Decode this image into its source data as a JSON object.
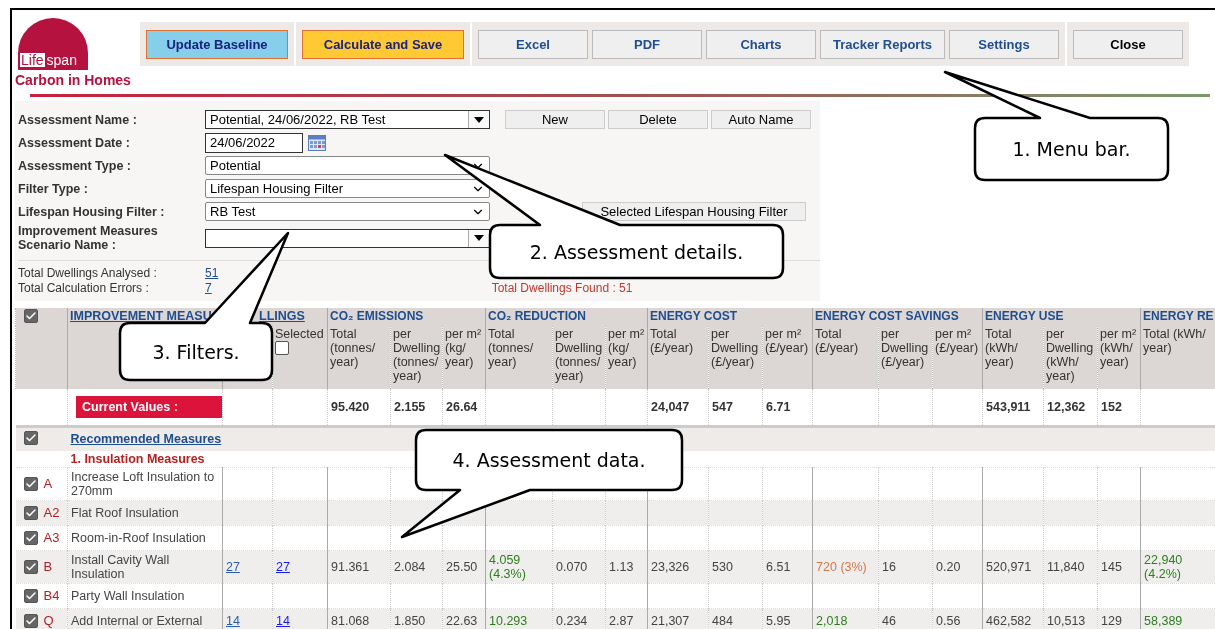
{
  "logo": {
    "word_1": "Life",
    "word_2": "span",
    "subtitle": "Carbon in Homes"
  },
  "toolbar_groups": [
    {
      "buttons": [
        {
          "label": "Update Baseline",
          "kind": "primary"
        }
      ]
    },
    {
      "buttons": [
        {
          "label": "Calculate and Save",
          "kind": "accent"
        }
      ]
    },
    {
      "buttons": [
        {
          "label": "Excel",
          "kind": "normal"
        },
        {
          "label": "PDF",
          "kind": "normal"
        },
        {
          "label": "Charts",
          "kind": "normal"
        },
        {
          "label": "Tracker Reports",
          "kind": "normal"
        },
        {
          "label": "Settings",
          "kind": "normal"
        }
      ]
    },
    {
      "buttons": [
        {
          "label": "Close",
          "kind": "close"
        }
      ]
    }
  ],
  "form": {
    "fields": [
      {
        "label": "Assessment Name :",
        "value": "Potential, 24/06/2022, RB Test",
        "kind": "combo"
      },
      {
        "label": "Assessment Date :",
        "value": "24/06/2022",
        "kind": "date"
      },
      {
        "label": "Assessment Type :",
        "value": "Potential",
        "kind": "select"
      },
      {
        "label": "Filter Type :",
        "value": "Lifespan Housing Filter",
        "kind": "select"
      },
      {
        "label": "Lifespan Housing Filter :",
        "value": "RB Test",
        "kind": "select"
      },
      {
        "label": "Improvement Measures Scenario Name :",
        "kind": "combo"
      }
    ],
    "buttons": [
      "New",
      "Delete",
      "Auto Name"
    ],
    "filter_button": "Selected Lifespan Housing Filter",
    "totals": [
      {
        "label": "Total Dwellings Analysed :",
        "value": "51"
      },
      {
        "label": "Total Calculation Errors :",
        "value": "7"
      }
    ],
    "found": "Total Dwellings Found : 51"
  },
  "table": {
    "all_checked": true,
    "measure_title": "IMPROVEMENT MEASU",
    "dwellings": {
      "title": "LLINGS",
      "selected_label": "Selected",
      "selected_checked": false
    },
    "groups": [
      {
        "title": "CO₂ EMISSIONS",
        "columns": [
          "Total (tonnes/ year)",
          "per Dwelling (tonnes/ year)",
          "per m² (kg/ year)"
        ],
        "current": [
          "95.420",
          "2.155",
          "26.64"
        ]
      },
      {
        "title": "CO₂ REDUCTION",
        "columns": [
          "Total (tonnes/ year)",
          "per Dwelling (tonnes/ year)",
          "per m² (kg/ year)"
        ]
      },
      {
        "title": "ENERGY COST",
        "columns": [
          "Total (£/year)",
          "per Dwelling (£/year)",
          "per m² (£/year)"
        ],
        "current": [
          "24,047",
          "547",
          "6.71"
        ]
      },
      {
        "title": "ENERGY COST SAVINGS",
        "columns": [
          "Total (£/year)",
          "per Dwelling (£/year)",
          "per m² (£/year)"
        ]
      },
      {
        "title": "ENERGY USE",
        "columns": [
          "Total (kWh/ year)",
          "per Dwelling (kWh/ year)",
          "per m² (kWh/ year)"
        ],
        "current": [
          "543,911",
          "12,362",
          "152"
        ]
      },
      {
        "title": "ENERGY RE",
        "columns": [
          "Total (kWh/ year)"
        ]
      }
    ],
    "current_label": "Current Values :",
    "section": {
      "title": "Recommended Measures",
      "checked": true
    },
    "category": "1. Insulation Measures",
    "rows": [
      {
        "checked": true,
        "code": "A",
        "name": "Increase Loft Insulation to 270mm"
      },
      {
        "checked": true,
        "code": "A2",
        "name": "Flat Roof Insulation"
      },
      {
        "checked": true,
        "code": "A3",
        "name": "Room-in-Roof Insulation"
      },
      {
        "checked": true,
        "code": "B",
        "name": "Install Cavity Wall Insulation",
        "dwellings": [
          "27",
          "27"
        ],
        "values": [
          [
            "91.361",
            "2.084",
            "25.50"
          ],
          [
            {
              "text": "4.059 (4.3%)",
              "color": "#2e7d1e"
            },
            "0.070",
            "1.13"
          ],
          [
            "23,326",
            "530",
            "6.51"
          ],
          [
            {
              "text": "720 (3%)",
              "color": "#d4784a"
            },
            "16",
            "0.20"
          ],
          [
            "520,971",
            "11,840",
            "145"
          ],
          [
            {
              "text": "22,940 (4.2%)",
              "color": "#2e7d1e"
            }
          ]
        ]
      },
      {
        "checked": true,
        "code": "B4",
        "name": "Party Wall Insulation"
      },
      {
        "checked": true,
        "code": "Q",
        "name": "Add Internal or External",
        "dwellings": [
          "14",
          "14"
        ],
        "values": [
          [
            "81.068",
            "1.850",
            "22.63"
          ],
          [
            {
              "text": "10.293",
              "color": "#2e7d1e"
            },
            "0.234",
            "2.87"
          ],
          [
            "21,307",
            "484",
            "5.95"
          ],
          [
            {
              "text": "2,018",
              "color": "#2e7d1e"
            },
            "46",
            "0.56"
          ],
          [
            "462,582",
            "10,513",
            "129"
          ],
          [
            {
              "text": "58,389",
              "color": "#2e7d1e"
            }
          ]
        ]
      }
    ]
  },
  "callouts": [
    {
      "text": "1. Menu bar."
    },
    {
      "text": "2. Assessment details."
    },
    {
      "text": "3. Filters."
    },
    {
      "text": "4. Assessment data."
    }
  ]
}
